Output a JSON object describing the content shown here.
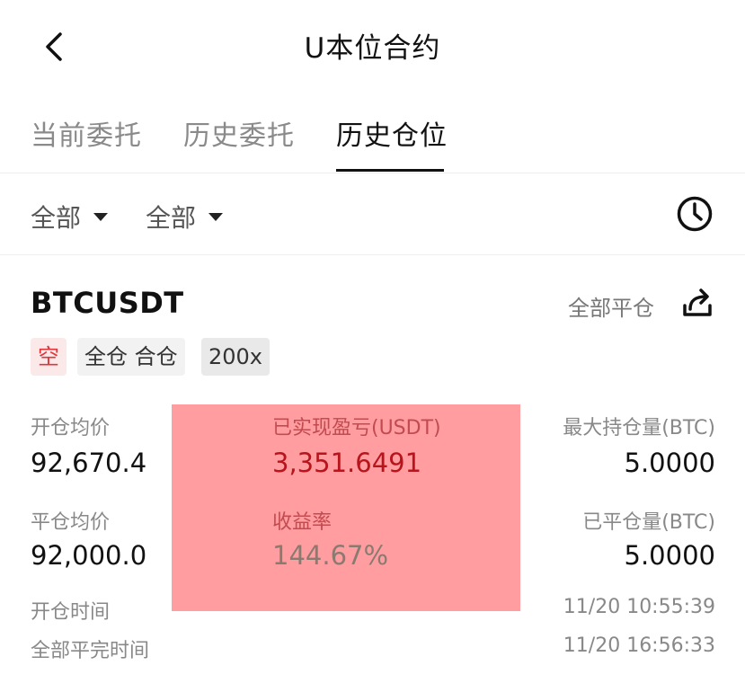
{
  "header": {
    "title": "U本位合约",
    "back_icon": "chevron-left-icon"
  },
  "tabs": [
    {
      "label": "当前委托",
      "active": false
    },
    {
      "label": "历史委托",
      "active": false
    },
    {
      "label": "历史仓位",
      "active": true
    }
  ],
  "filters": {
    "filter1": "全部",
    "filter2": "全部",
    "clock_icon": "clock-icon",
    "caret_icon": "caret-down-icon"
  },
  "position": {
    "symbol": "BTCUSDT",
    "close_all_label": "全部平仓",
    "share_icon": "share-icon",
    "tags": {
      "side": "空",
      "margin_mode": "全仓 合仓",
      "leverage": "200x"
    },
    "avg_open_price_label": "开仓均价",
    "avg_open_price": "92,670.4",
    "realized_pnl_label": "已实现盈亏(USDT)",
    "realized_pnl": "3,351.6491",
    "max_position_label": "最大持仓量(BTC)",
    "max_position": "5.0000",
    "avg_close_price_label": "平仓均价",
    "avg_close_price": "92,000.0",
    "roe_label": "收益率",
    "roe": "144.67%",
    "closed_qty_label": "已平仓量(BTC)",
    "closed_qty": "5.0000",
    "open_time_label": "开仓时间",
    "open_time": "11/20 10:55:39",
    "close_time_label": "全部平完时间",
    "close_time": "11/20 16:56:33"
  },
  "colors": {
    "short": "#e0353b",
    "highlight": "#ff9da0",
    "pnl": "#b8141c"
  }
}
